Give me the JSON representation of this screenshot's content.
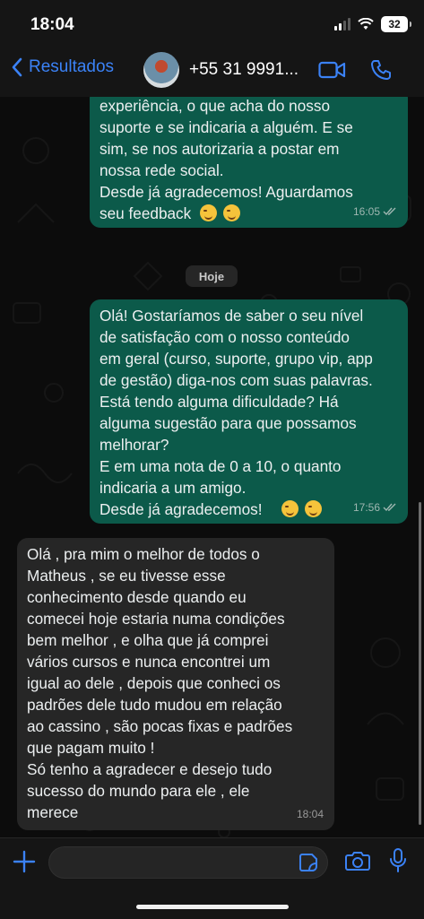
{
  "status_bar": {
    "time": "18:04",
    "battery": "32"
  },
  "header": {
    "back_label": "Resultados",
    "contact_name": "+55 31 9991..."
  },
  "messages": [
    {
      "direction": "outgoing",
      "text": "experiência, o que acha do nosso\nsuporte e se indicaria a alguém. E se\nsim, se nos autorizaria a postar em\nnossa rede social.\nDesde já agradecemos! Aguardamos\nseu feedback",
      "emojis": 2,
      "time": "16:05"
    },
    {
      "direction": "outgoing",
      "text": "Olá! Gostaríamos de saber o seu nível\nde satisfação com o nosso conteúdo\nem geral (curso, suporte, grupo vip, app\nde gestão) diga-nos com suas palavras.\nEstá tendo alguma dificuldade? Há\nalguma sugestão para que possamos\nmelhorar?\nE em uma nota de 0 a 10, o quanto\nindicaria a um amigo.\nDesde já agradecemos!",
      "emojis": 2,
      "time": "17:56"
    },
    {
      "direction": "incoming",
      "text": "Olá , pra mim o melhor de todos o\nMatheus , se eu tivesse esse\nconhecimento desde quando eu\ncomecei hoje estaria numa condições\nbem melhor , e olha que já comprei\nvários cursos e nunca encontrei um\nigual ao dele , depois que conheci os\npadrões dele tudo mudou em relação\nao cassino , são pocas fixas e padrões\nque pagam muito !\nSó tenho a agradecer e desejo tudo\nsucesso do mundo para ele , ele\nmerece",
      "time": "18:04"
    }
  ],
  "date_separator": "Hoje",
  "composer": {
    "placeholder": ""
  },
  "colors": {
    "accent": "#3b82f6",
    "outgoing_bubble": "#0c5a4a",
    "incoming_bubble": "#262626"
  }
}
